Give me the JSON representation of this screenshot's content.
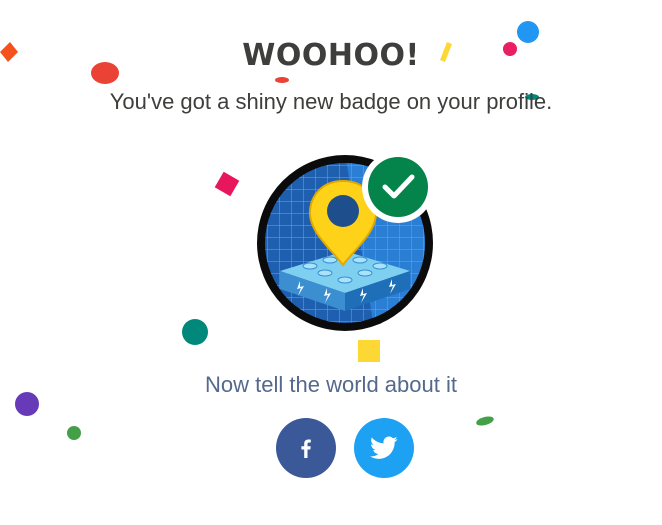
{
  "header": {
    "title": "WOOHOO!",
    "message": "You've got a shiny new badge on your profile."
  },
  "badge": {
    "icon": "lego-bricks-location-pin-badge",
    "status_icon": "checkmark-icon",
    "status_color": "#04844b"
  },
  "share": {
    "prompt": "Now tell the world about it",
    "buttons": [
      {
        "network": "facebook",
        "icon": "facebook-icon",
        "color": "#3b5998"
      },
      {
        "network": "twitter",
        "icon": "twitter-icon",
        "color": "#1da1f2"
      }
    ]
  },
  "colors": {
    "heading": "#3e3e3c",
    "prompt": "#54698d"
  }
}
